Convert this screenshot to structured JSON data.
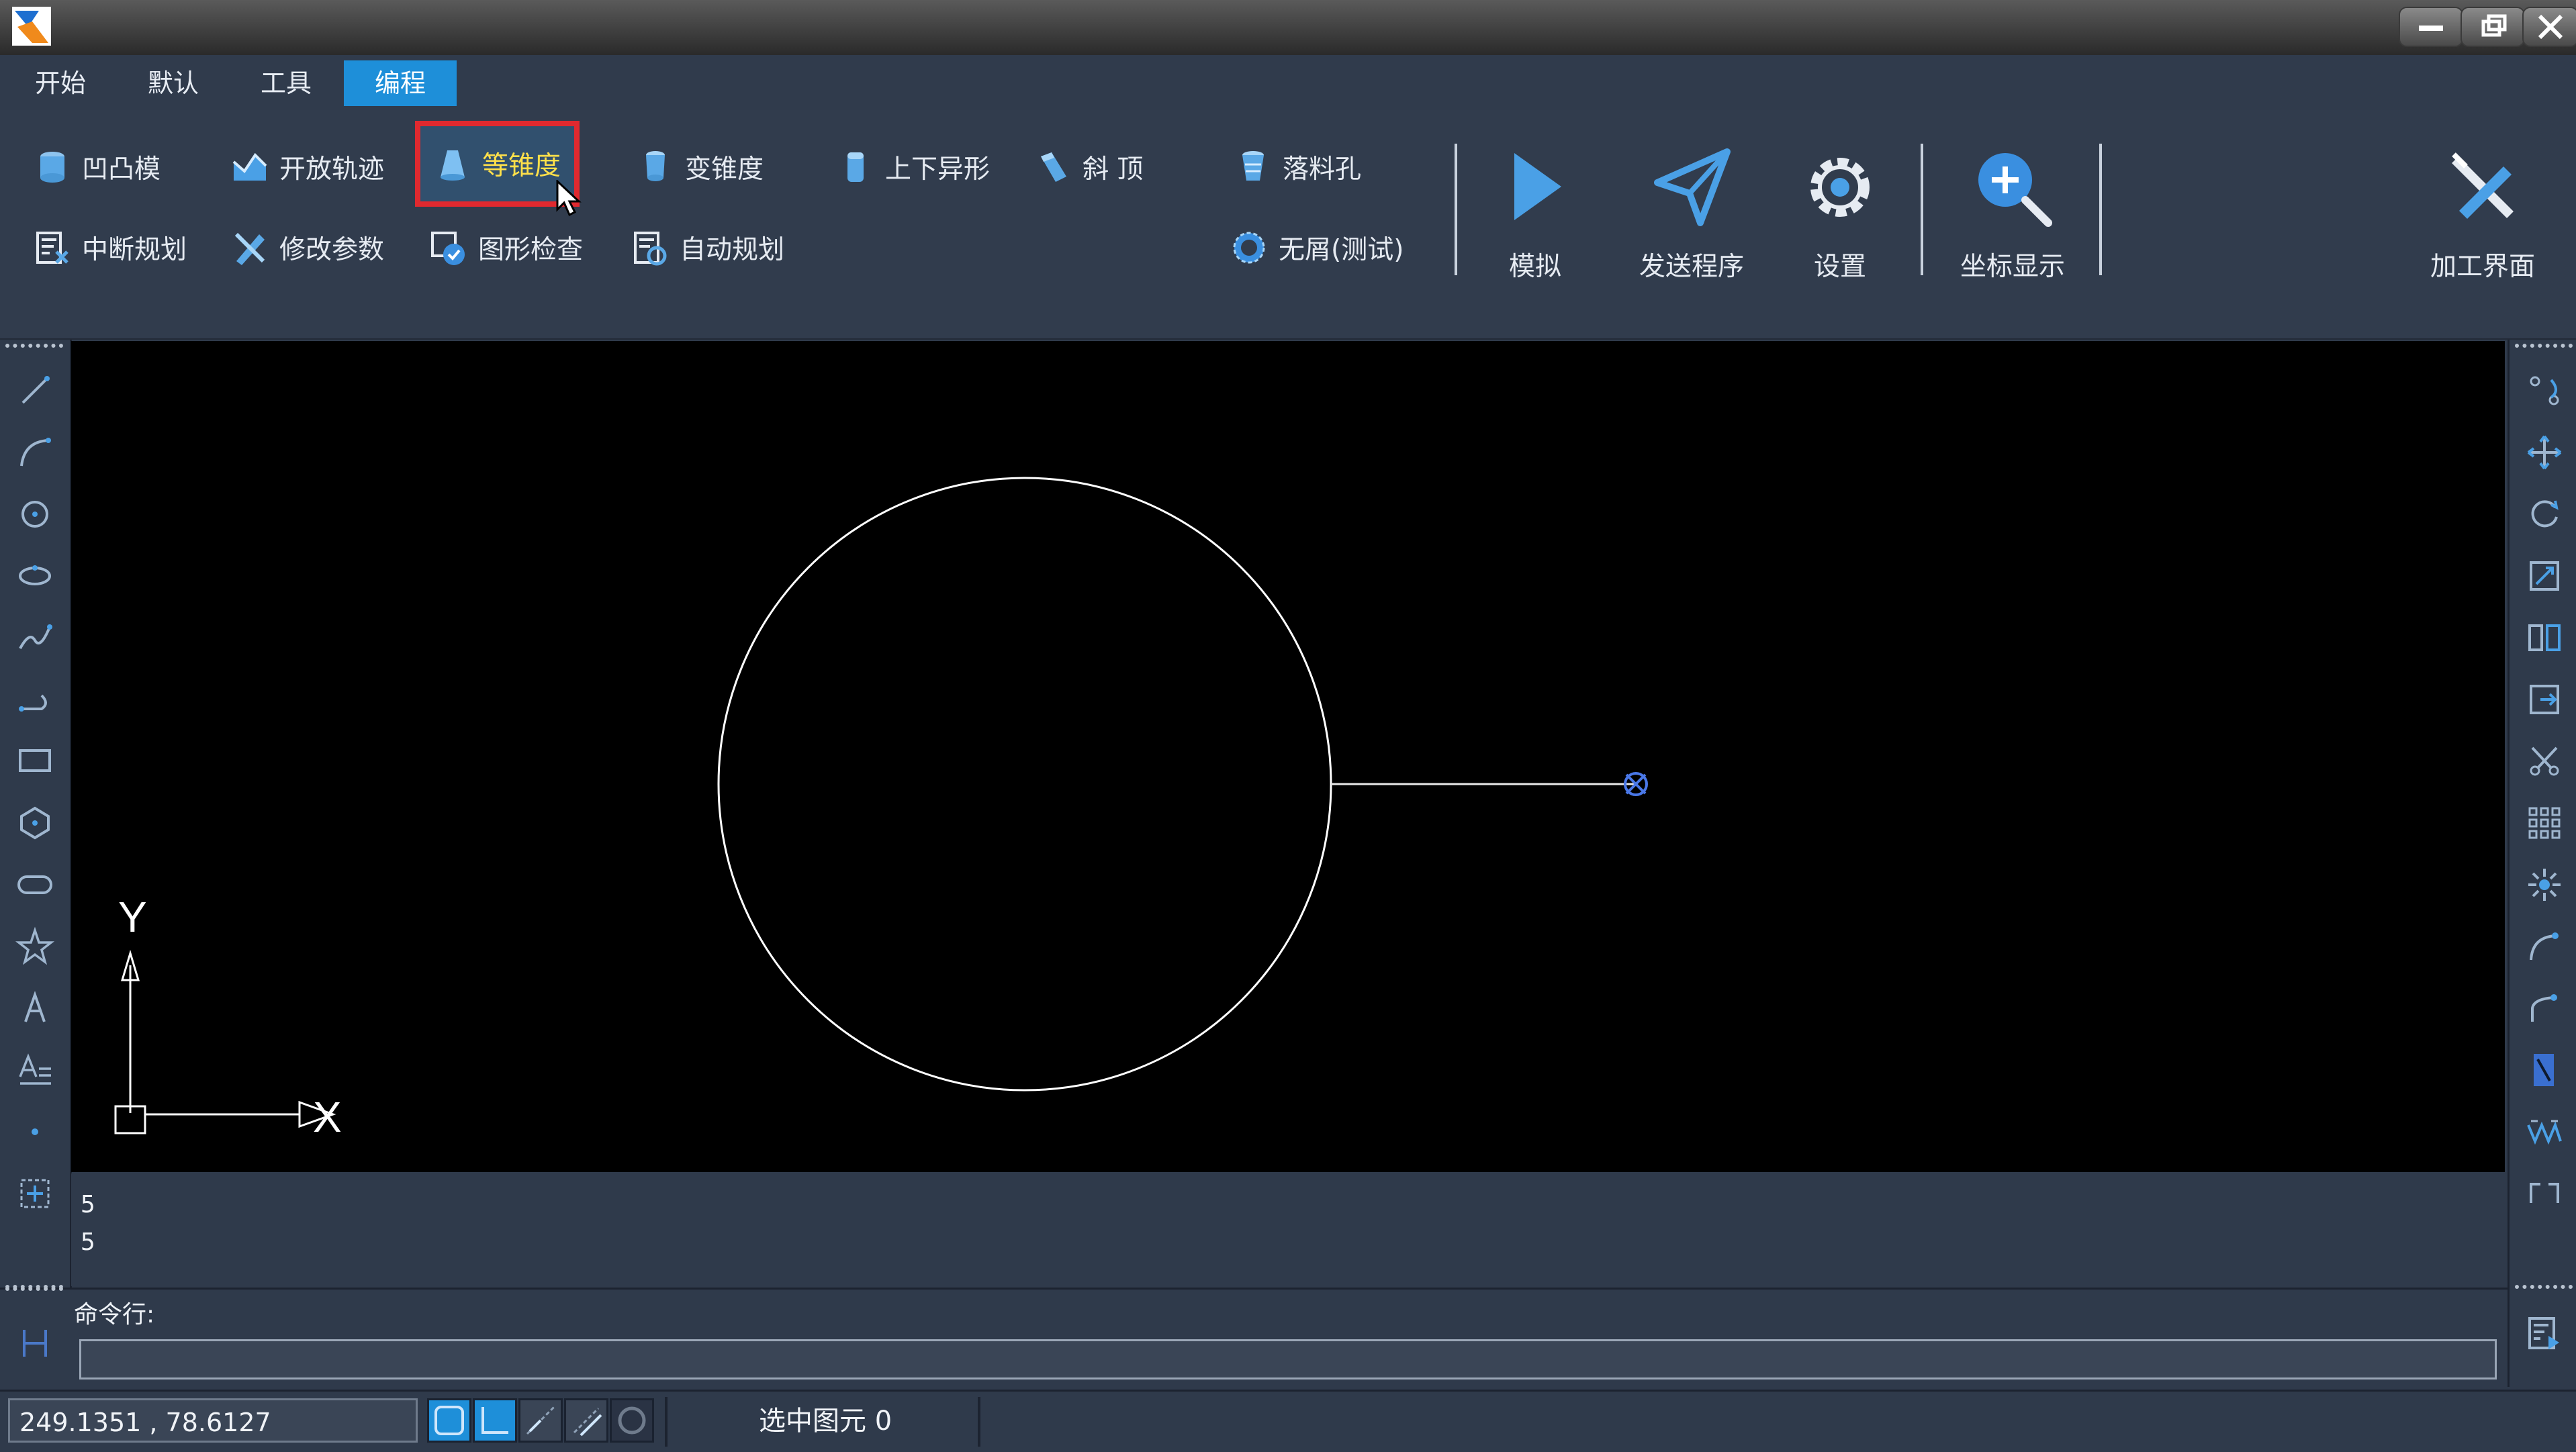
{
  "menu": {
    "tabs": [
      {
        "label": "开始"
      },
      {
        "label": "默认"
      },
      {
        "label": "工具"
      },
      {
        "label": "编程",
        "active": true
      }
    ]
  },
  "ribbon": {
    "row1": [
      {
        "label": "凹凸模",
        "icon": "cylinder-icon"
      },
      {
        "label": "开放轨迹",
        "icon": "open-path-icon"
      },
      {
        "label": "等锥度",
        "icon": "cone-icon",
        "highlighted": true
      },
      {
        "label": "变锥度",
        "icon": "variable-taper-icon"
      },
      {
        "label": "上下异形",
        "icon": "upper-lower-shape-icon"
      },
      {
        "label": "斜 顶",
        "icon": "slant-top-icon"
      },
      {
        "label": "落料孔",
        "icon": "blanking-hole-icon"
      }
    ],
    "row2": [
      {
        "label": "中断规划",
        "icon": "break-plan-icon"
      },
      {
        "label": "修改参数",
        "icon": "edit-params-icon"
      },
      {
        "label": "图形检查",
        "icon": "shape-check-icon"
      },
      {
        "label": "自动规划",
        "icon": "auto-plan-icon"
      },
      {
        "label": "无屑(测试)",
        "icon": "chipless-icon"
      }
    ],
    "big": [
      {
        "label": "模拟",
        "icon": "play-icon"
      },
      {
        "label": "发送程序",
        "icon": "send-icon"
      },
      {
        "label": "设置",
        "icon": "gear-icon"
      },
      {
        "label": "坐标显示",
        "icon": "zoom-icon"
      },
      {
        "label": "加工界面",
        "icon": "machining-icon"
      }
    ]
  },
  "canvas": {
    "axis_y_label": "Y",
    "axis_x_label": "X"
  },
  "output": {
    "lines": [
      "5",
      "5"
    ]
  },
  "command": {
    "label": "命令行:",
    "value": ""
  },
  "status": {
    "coordinates": "249.1351 , 78.6127",
    "selection": "选中图元 0"
  },
  "colors": {
    "accent": "#1e8fd9",
    "highlight_box": "#e0292f",
    "canvas_bg": "#000000",
    "ui_bg": "#2f3a4b"
  }
}
